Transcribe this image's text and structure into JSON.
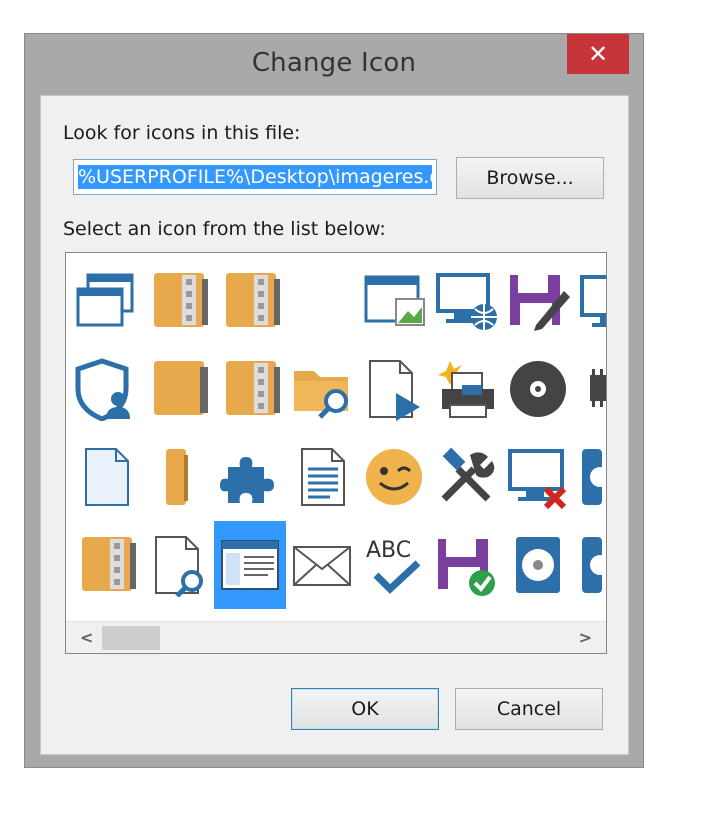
{
  "window": {
    "title": "Change Icon",
    "close_glyph": "✕"
  },
  "dialog": {
    "file_label": "Look for icons in this file:",
    "file_value": "%USERPROFILE%\\Desktop\\imageres.dll",
    "browse_label": "Browse...",
    "list_label": "Select an icon from the list below:",
    "ok_label": "OK",
    "cancel_label": "Cancel"
  },
  "icons": [
    [
      "windows-stack-icon",
      "folder-zip-icon",
      "folder-zip-icon",
      "",
      "window-picture-icon",
      "monitor-globe-icon",
      "floppy-edit-icon",
      "monitor-icon"
    ],
    [
      "shield-user-icon",
      "folder-closed-icon",
      "folder-zip-icon",
      "folder-search-icon",
      "document-play-icon",
      "printer-spark-icon",
      "disc-icon",
      "chip-icon"
    ],
    [
      "blank-document-icon",
      "folder-thin-icon",
      "puzzle-icon",
      "text-document-icon",
      "wink-smiley-icon",
      "tools-icon",
      "monitor-error-icon",
      "drive-icon"
    ],
    [
      "folder-zip-icon",
      "document-search-icon",
      "window-list-icon",
      "envelope-icon",
      "spellcheck-icon",
      "floppy-check-icon",
      "hard-disk-icon",
      "drive-icon"
    ]
  ],
  "selected_icon": {
    "row": 3,
    "col": 2
  },
  "scroll": {
    "left_glyph": "<",
    "right_glyph": ">"
  },
  "colors": {
    "selection": "#3399ff",
    "folder": "#e8a94c",
    "icon_blue": "#2d6fa8",
    "close": "#c7343a"
  }
}
